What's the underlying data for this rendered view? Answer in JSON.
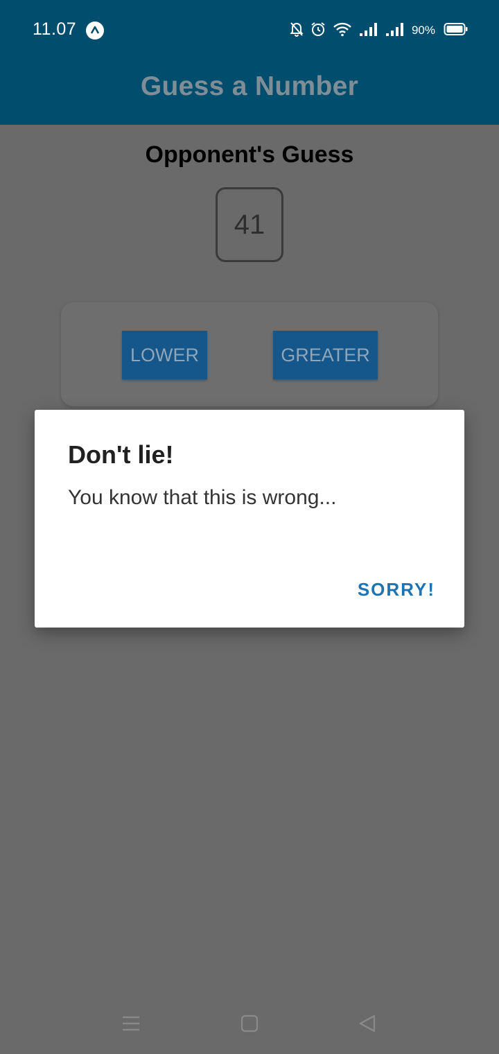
{
  "status_bar": {
    "time": "11.07",
    "battery_percent": "90%",
    "icons": [
      "app-badge-icon",
      "notifications-off-icon",
      "alarm-icon",
      "wifi-icon",
      "signal-1-icon",
      "signal-2-icon",
      "battery-icon"
    ]
  },
  "header": {
    "title": "Guess a Number"
  },
  "game": {
    "heading": "Opponent's Guess",
    "guess": "41",
    "lower_label": "LOWER",
    "greater_label": "GREATER"
  },
  "dialog": {
    "title": "Don't lie!",
    "message": "You know that this is wrong...",
    "action_label": "SORRY!"
  },
  "colors": {
    "header_bg": "#004d6d",
    "overlay_bg": "#6a6a6a",
    "button_bg": "#15568b",
    "dialog_action": "#1e74b3"
  },
  "nav_bar": {
    "icons": [
      "menu-icon",
      "home-icon",
      "back-icon"
    ]
  }
}
